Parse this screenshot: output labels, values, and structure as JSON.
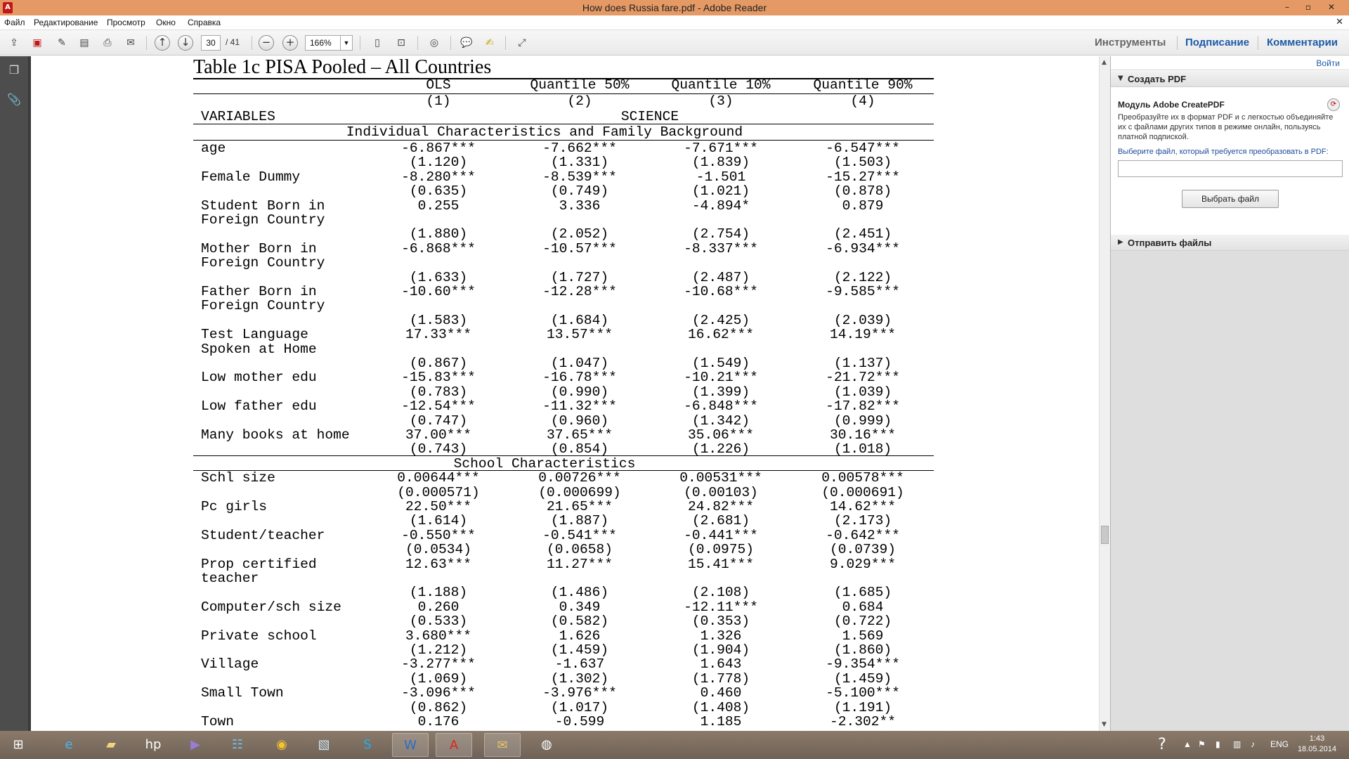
{
  "window": {
    "title": "How does Russia fare.pdf - Adobe Reader",
    "controls": [
      "–",
      "▫",
      "✕"
    ]
  },
  "menu": [
    "Файл",
    "Редактирование",
    "Просмотр",
    "Окно",
    "Справка"
  ],
  "toolbar": {
    "page_current": "30",
    "page_total": "/ 41",
    "zoom": "166%",
    "right_links": [
      "Инструменты",
      "Подписание",
      "Комментарии"
    ]
  },
  "document": {
    "table_title": "Table 1c PISA Pooled – All Countries",
    "columns": [
      "OLS",
      "Quantile 50%",
      "Quantile 10%",
      "Quantile 90%"
    ],
    "column_numbers": [
      "(1)",
      "(2)",
      "(3)",
      "(4)"
    ],
    "variables_label": "VARIABLES",
    "dependent_label": "SCIENCE",
    "section1": "Individual Characteristics and Family Background",
    "section2": "School Characteristics",
    "rows1": [
      {
        "label": [
          "age"
        ],
        "coef": [
          "-6.867***",
          "-7.662***",
          "-7.671***",
          "-6.547***"
        ],
        "se": [
          "(1.120)",
          "(1.331)",
          "(1.839)",
          "(1.503)"
        ]
      },
      {
        "label": [
          "Female Dummy"
        ],
        "coef": [
          "-8.280***",
          "-8.539***",
          "-1.501",
          "-15.27***"
        ],
        "se": [
          "(0.635)",
          "(0.749)",
          "(1.021)",
          "(0.878)"
        ]
      },
      {
        "label": [
          "Student Born in",
          "Foreign Country"
        ],
        "coef": [
          "0.255",
          "3.336",
          "-4.894*",
          "0.879"
        ],
        "se": [
          "(1.880)",
          "(2.052)",
          "(2.754)",
          "(2.451)"
        ]
      },
      {
        "label": [
          "Mother Born in",
          "Foreign Country"
        ],
        "coef": [
          "-6.868***",
          "-10.57***",
          "-8.337***",
          "-6.934***"
        ],
        "se": [
          "(1.633)",
          "(1.727)",
          "(2.487)",
          "(2.122)"
        ]
      },
      {
        "label": [
          "Father Born in",
          "Foreign Country"
        ],
        "coef": [
          "-10.60***",
          "-12.28***",
          "-10.68***",
          "-9.585***"
        ],
        "se": [
          "(1.583)",
          "(1.684)",
          "(2.425)",
          "(2.039)"
        ]
      },
      {
        "label": [
          "Test Language",
          "Spoken at Home"
        ],
        "coef": [
          "17.33***",
          "13.57***",
          "16.62***",
          "14.19***"
        ],
        "se": [
          "(0.867)",
          "(1.047)",
          "(1.549)",
          "(1.137)"
        ]
      },
      {
        "label": [
          "Low mother edu"
        ],
        "coef": [
          "-15.83***",
          "-16.78***",
          "-10.21***",
          "-21.72***"
        ],
        "se": [
          "(0.783)",
          "(0.990)",
          "(1.399)",
          "(1.039)"
        ]
      },
      {
        "label": [
          "Low father edu"
        ],
        "coef": [
          "-12.54***",
          "-11.32***",
          "-6.848***",
          "-17.82***"
        ],
        "se": [
          "(0.747)",
          "(0.960)",
          "(1.342)",
          "(0.999)"
        ]
      },
      {
        "label": [
          "Many books at home"
        ],
        "coef": [
          "37.00***",
          "37.65***",
          "35.06***",
          "30.16***"
        ],
        "se": [
          "(0.743)",
          "(0.854)",
          "(1.226)",
          "(1.018)"
        ]
      }
    ],
    "rows2": [
      {
        "label": [
          "Schl size"
        ],
        "coef": [
          "0.00644***",
          "0.00726***",
          "0.00531***",
          "0.00578***"
        ],
        "se": [
          "(0.000571)",
          "(0.000699)",
          "(0.00103)",
          "(0.000691)"
        ]
      },
      {
        "label": [
          "Pc girls"
        ],
        "coef": [
          "22.50***",
          "21.65***",
          "24.82***",
          "14.62***"
        ],
        "se": [
          "(1.614)",
          "(1.887)",
          "(2.681)",
          "(2.173)"
        ]
      },
      {
        "label": [
          "Student/teacher"
        ],
        "coef": [
          "-0.550***",
          "-0.541***",
          "-0.441***",
          "-0.642***"
        ],
        "se": [
          "(0.0534)",
          "(0.0658)",
          "(0.0975)",
          "(0.0739)"
        ]
      },
      {
        "label": [
          "Prop certified",
          "teacher"
        ],
        "coef": [
          "12.63***",
          "11.27***",
          "15.41***",
          "9.029***"
        ],
        "se": [
          "(1.188)",
          "(1.486)",
          "(2.108)",
          "(1.685)"
        ]
      },
      {
        "label": [
          "Computer/sch size"
        ],
        "coef": [
          "0.260",
          "0.349",
          "-12.11***",
          "0.684"
        ],
        "se": [
          "(0.533)",
          "(0.582)",
          "(0.353)",
          "(0.722)"
        ]
      },
      {
        "label": [
          "Private school"
        ],
        "coef": [
          "3.680***",
          "1.626",
          "1.326",
          "1.569"
        ],
        "se": [
          "(1.212)",
          "(1.459)",
          "(1.904)",
          "(1.860)"
        ]
      },
      {
        "label": [
          "Village"
        ],
        "coef": [
          "-3.277***",
          "-1.637",
          "1.643",
          "-9.354***"
        ],
        "se": [
          "(1.069)",
          "(1.302)",
          "(1.778)",
          "(1.459)"
        ]
      },
      {
        "label": [
          "Small Town"
        ],
        "coef": [
          "-3.096***",
          "-3.976***",
          "0.460",
          "-5.100***"
        ],
        "se": [
          "(0.862)",
          "(1.017)",
          "(1.408)",
          "(1.191)"
        ]
      },
      {
        "label": [
          "Town"
        ],
        "coef": [
          "0.176",
          "-0.599",
          "1.185",
          "-2.302**"
        ],
        "se": []
      }
    ]
  },
  "right_panel": {
    "login": "Войти",
    "create_pdf": "Создать PDF",
    "module_title": "Модуль Adobe CreatePDF",
    "module_desc": "Преобразуйте их в формат PDF и с легкостью объединяйте их с файлами других типов в режиме онлайн, пользуясь платной подпиской.",
    "prompt": "Выберите файл, который требуется преобразовать в PDF:",
    "select_file": "Выбрать файл",
    "send_files": "Отправить файлы"
  },
  "taskbar": {
    "lang": "ENG",
    "time": "1:43",
    "date": "18.05.2014"
  },
  "colors": {
    "titlebar": "#e59a65",
    "link_blue": "#1e5aa8",
    "taskbar": "#7a6c5f"
  }
}
